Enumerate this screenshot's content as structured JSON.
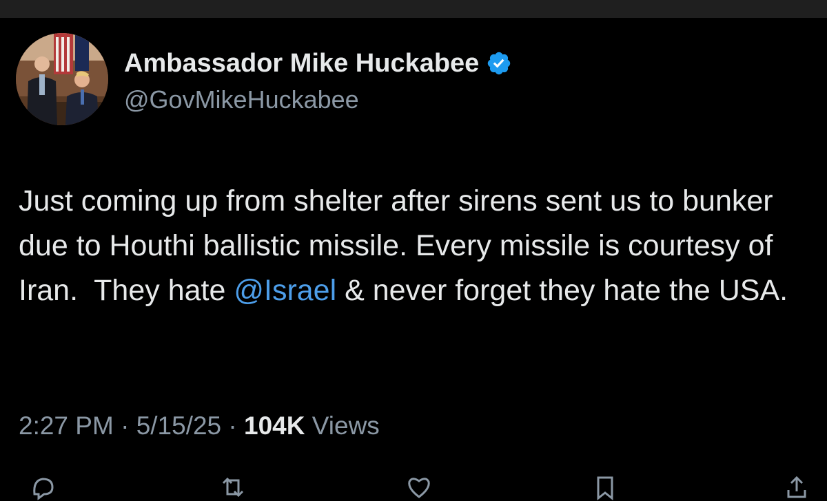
{
  "author": {
    "display_name": "Ambassador Mike Huckabee",
    "handle": "@GovMikeHuckabee",
    "verified_icon": "verified-badge-icon",
    "verified_color": "#1d9bf0"
  },
  "tweet": {
    "text_before_mention": "Just coming up from shelter after sirens sent us to bunker due to Houthi ballistic missile. Every missile is courtesy of Iran.  They hate ",
    "mention": "@Israel",
    "text_after_mention": " & never forget they hate the USA."
  },
  "meta": {
    "time": "2:27 PM",
    "separator_1": " · ",
    "date": "5/15/25",
    "separator_2": " · ",
    "views_count": "104K",
    "views_label": " Views"
  },
  "actions": {
    "reply_icon": "reply-icon",
    "retweet_icon": "retweet-icon",
    "like_icon": "like-icon",
    "bookmark_icon": "bookmark-icon",
    "share_icon": "share-icon"
  },
  "colors": {
    "background": "#000000",
    "text": "#e7e9ea",
    "secondary": "#8b98a5",
    "link": "#4d9eea"
  }
}
